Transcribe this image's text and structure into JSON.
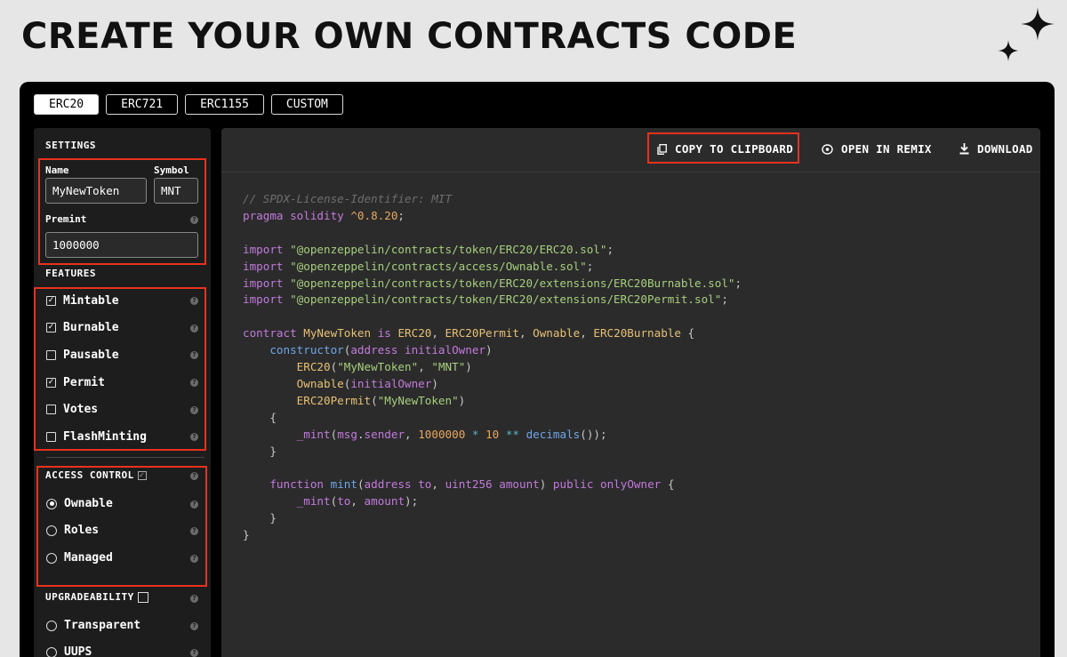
{
  "header": {
    "title": "CREATE YOUR OWN CONTRACTS CODE"
  },
  "tabs": [
    {
      "label": "ERC20",
      "active": true
    },
    {
      "label": "ERC721",
      "active": false
    },
    {
      "label": "ERC1155",
      "active": false
    },
    {
      "label": "CUSTOM",
      "active": false
    }
  ],
  "settings": {
    "title": "SETTINGS",
    "name_label": "Name",
    "name_value": "MyNewToken",
    "symbol_label": "Symbol",
    "symbol_value": "MNT",
    "premint_label": "Premint",
    "premint_value": "1000000"
  },
  "features": {
    "title": "FEATURES",
    "items": [
      {
        "label": "Mintable",
        "checked": true
      },
      {
        "label": "Burnable",
        "checked": true
      },
      {
        "label": "Pausable",
        "checked": false
      },
      {
        "label": "Permit",
        "checked": true
      },
      {
        "label": "Votes",
        "checked": false
      },
      {
        "label": "FlashMinting",
        "checked": false
      }
    ]
  },
  "access_control": {
    "title": "ACCESS CONTROL",
    "enabled": true,
    "options": [
      {
        "label": "Ownable",
        "selected": true
      },
      {
        "label": "Roles",
        "selected": false
      },
      {
        "label": "Managed",
        "selected": false
      }
    ]
  },
  "upgradeability": {
    "title": "UPGRADEABILITY",
    "enabled": false,
    "options": [
      {
        "label": "Transparent",
        "selected": false
      },
      {
        "label": "UUPS",
        "selected": false
      }
    ]
  },
  "toolbar": {
    "copy_label": "COPY TO CLIPBOARD",
    "remix_label": "OPEN IN REMIX",
    "download_label": "DOWNLOAD"
  },
  "code": {
    "license": "// SPDX-License-Identifier: MIT",
    "pragma_kw": "pragma solidity",
    "pragma_ver": "^0.8.20",
    "imports": [
      "\"@openzeppelin/contracts/token/ERC20/ERC20.sol\"",
      "\"@openzeppelin/contracts/access/Ownable.sol\"",
      "\"@openzeppelin/contracts/token/ERC20/extensions/ERC20Burnable.sol\"",
      "\"@openzeppelin/contracts/token/ERC20/extensions/ERC20Permit.sol\""
    ],
    "contract_name": "MyNewToken",
    "inherits": [
      "ERC20",
      "ERC20Permit",
      "Ownable",
      "ERC20Burnable"
    ],
    "token_name_str": "\"MyNewToken\"",
    "token_symbol_str": "\"MNT\"",
    "premint": "1000000",
    "decimals_base": "10"
  },
  "colors": {
    "accent_highlight": "#e8321e",
    "panel_bg": "#000000",
    "editor_bg": "#2b2b2b"
  },
  "icons": [
    "sparkle-icon",
    "copy-icon",
    "remix-icon",
    "download-icon",
    "help-icon"
  ]
}
